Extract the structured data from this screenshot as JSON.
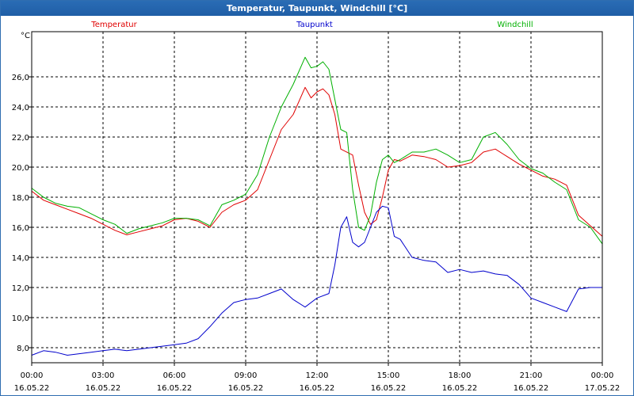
{
  "window": {
    "title": "Temperatur, Taupunkt, Windchill [°C]"
  },
  "chart_data": {
    "type": "line",
    "title": "Temperatur, Taupunkt, Windchill [°C]",
    "ylabel": "°C",
    "ylim": [
      7,
      29
    ],
    "yticks": [
      "8,0",
      "10,0",
      "12,0",
      "14,0",
      "16,0",
      "18,0",
      "20,0",
      "22,0",
      "24,0",
      "26,0"
    ],
    "ytick_values": [
      8,
      10,
      12,
      14,
      16,
      18,
      20,
      22,
      24,
      26
    ],
    "xlim": [
      0,
      24
    ],
    "xticks": [
      {
        "h": 0,
        "time": "00:00",
        "date": "16.05.22"
      },
      {
        "h": 3,
        "time": "03:00",
        "date": "16.05.22"
      },
      {
        "h": 6,
        "time": "06:00",
        "date": "16.05.22"
      },
      {
        "h": 9,
        "time": "09:00",
        "date": "16.05.22"
      },
      {
        "h": 12,
        "time": "12:00",
        "date": "16.05.22"
      },
      {
        "h": 15,
        "time": "15:00",
        "date": "16.05.22"
      },
      {
        "h": 18,
        "time": "18:00",
        "date": "16.05.22"
      },
      {
        "h": 21,
        "time": "21:00",
        "date": "16.05.22"
      },
      {
        "h": 24,
        "time": "00:00",
        "date": "17.05.22"
      }
    ],
    "grid": true,
    "series": [
      {
        "name": "Temperatur",
        "color": "#e00000",
        "x": [
          0,
          0.5,
          1,
          1.5,
          2,
          2.5,
          3,
          3.5,
          4,
          4.5,
          5,
          5.5,
          6,
          6.5,
          7,
          7.5,
          8,
          8.5,
          9,
          9.5,
          10,
          10.5,
          11,
          11.5,
          11.75,
          12,
          12.25,
          12.5,
          12.75,
          13,
          13.5,
          13.75,
          14,
          14.25,
          14.5,
          14.75,
          15,
          15.25,
          15.5,
          16,
          16.5,
          17,
          17.5,
          18,
          18.5,
          19,
          19.5,
          20,
          20.5,
          21,
          21.5,
          22,
          22.5,
          23,
          23.5,
          24
        ],
        "y": [
          18.4,
          17.8,
          17.5,
          17.2,
          16.9,
          16.6,
          16.2,
          15.8,
          15.5,
          15.7,
          15.9,
          16.1,
          16.5,
          16.6,
          16.4,
          16.0,
          17.0,
          17.5,
          17.8,
          18.5,
          20.5,
          22.5,
          23.5,
          25.3,
          24.6,
          25.0,
          25.2,
          24.8,
          23.5,
          21.2,
          20.8,
          18.8,
          17.0,
          16.2,
          16.5,
          18.0,
          19.8,
          20.5,
          20.4,
          20.8,
          20.7,
          20.5,
          20.0,
          20.1,
          20.3,
          21.0,
          21.2,
          20.7,
          20.2,
          19.8,
          19.4,
          19.2,
          18.8,
          16.8,
          16.1,
          15.4
        ]
      },
      {
        "name": "Taupunkt",
        "color": "#0000cc",
        "x": [
          0,
          0.5,
          1,
          1.5,
          2,
          2.5,
          3,
          3.5,
          4,
          4.5,
          5,
          5.5,
          6,
          6.5,
          7,
          7.5,
          8,
          8.5,
          9,
          9.5,
          10,
          10.5,
          11,
          11.5,
          12,
          12.5,
          12.75,
          13,
          13.25,
          13.5,
          13.75,
          14,
          14.25,
          14.5,
          14.75,
          15,
          15.25,
          15.5,
          16,
          16.5,
          17,
          17.5,
          18,
          18.5,
          19,
          19.5,
          20,
          20.5,
          21,
          21.5,
          22,
          22.5,
          23,
          23.5,
          24
        ],
        "y": [
          7.5,
          7.8,
          7.7,
          7.5,
          7.6,
          7.7,
          7.8,
          7.9,
          7.8,
          7.9,
          8.0,
          8.1,
          8.2,
          8.3,
          8.6,
          9.4,
          10.3,
          11.0,
          11.2,
          11.3,
          11.6,
          11.9,
          11.2,
          10.7,
          11.3,
          11.6,
          13.5,
          16.0,
          16.7,
          15.0,
          14.7,
          15.0,
          16.0,
          17.0,
          17.4,
          17.3,
          15.4,
          15.2,
          14.0,
          13.8,
          13.7,
          13.0,
          13.2,
          13.0,
          13.1,
          12.9,
          12.8,
          12.2,
          11.3,
          11.0,
          10.7,
          10.4,
          11.9,
          12.0,
          12.0
        ]
      },
      {
        "name": "Windchill",
        "color": "#00b000",
        "x": [
          0,
          0.5,
          1,
          1.5,
          2,
          2.5,
          3,
          3.5,
          4,
          4.5,
          5,
          5.5,
          6,
          6.5,
          7,
          7.5,
          8,
          8.5,
          9,
          9.5,
          10,
          10.5,
          11,
          11.5,
          11.75,
          12,
          12.25,
          12.5,
          12.75,
          13,
          13.25,
          13.5,
          13.75,
          14,
          14.25,
          14.5,
          14.75,
          15,
          15.25,
          15.5,
          16,
          16.5,
          17,
          17.5,
          18,
          18.5,
          19,
          19.5,
          20,
          20.5,
          21,
          21.5,
          22,
          22.5,
          23,
          23.5,
          24
        ],
        "y": [
          18.6,
          18.0,
          17.6,
          17.4,
          17.3,
          16.9,
          16.5,
          16.2,
          15.6,
          15.9,
          16.1,
          16.3,
          16.6,
          16.6,
          16.5,
          16.1,
          17.5,
          17.8,
          18.2,
          19.5,
          22.0,
          24.0,
          25.5,
          27.3,
          26.6,
          26.7,
          27.0,
          26.5,
          24.5,
          22.5,
          22.3,
          18.5,
          16.0,
          15.8,
          16.8,
          19.0,
          20.5,
          20.8,
          20.3,
          20.5,
          21.0,
          21.0,
          21.2,
          20.8,
          20.3,
          20.5,
          22.0,
          22.3,
          21.5,
          20.5,
          19.9,
          19.6,
          19.0,
          18.5,
          16.5,
          16.0,
          14.9
        ]
      }
    ]
  }
}
